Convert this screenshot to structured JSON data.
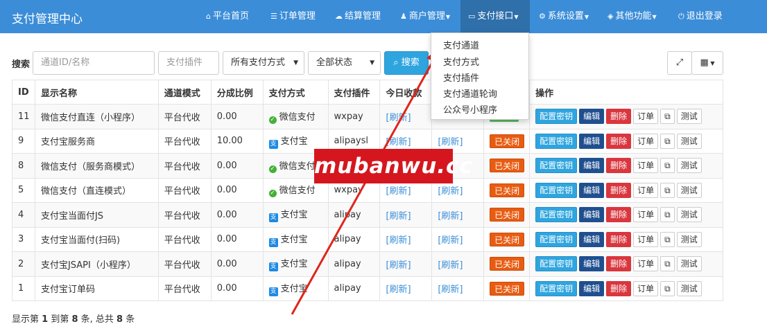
{
  "app": {
    "title": "支付管理中心"
  },
  "nav": [
    {
      "icon": "home-icon",
      "glyph": "⌂",
      "label": "平台首页"
    },
    {
      "icon": "list-icon",
      "glyph": "☰",
      "label": "订单管理"
    },
    {
      "icon": "cloud-icon",
      "glyph": "☁",
      "label": "结算管理"
    },
    {
      "icon": "user-icon",
      "glyph": "♟",
      "label": "商户管理"
    },
    {
      "icon": "credit-card-icon",
      "glyph": "▭",
      "label": "支付接口"
    },
    {
      "icon": "gear-icon",
      "glyph": "⚙",
      "label": "系统设置"
    },
    {
      "icon": "cube-icon",
      "glyph": "◈",
      "label": "其他功能"
    },
    {
      "icon": "power-icon",
      "glyph": "⏻",
      "label": "退出登录"
    }
  ],
  "dropdown": [
    "支付通道",
    "支付方式",
    "支付插件",
    "支付通道轮询",
    "公众号小程序"
  ],
  "search": {
    "label": "搜索",
    "id_placeholder": "通道ID/名称",
    "plugin_placeholder": "支付插件",
    "method_selected": "所有支付方式",
    "status_selected": "全部状态",
    "button": "搜索"
  },
  "table": {
    "headers": [
      "ID",
      "显示名称",
      "通道模式",
      "分成比例",
      "支付方式",
      "支付插件",
      "今日收款",
      "",
      "",
      "操作"
    ],
    "rows": [
      {
        "id": "11",
        "name": "微信支付直连（小程序）",
        "mode": "平台代收",
        "ratio": "0.00",
        "method": "微信支付",
        "method_icon": "wechat-icon",
        "plugin": "wxpay",
        "today": "[刷新]",
        "yesterday": "",
        "status": "",
        "status_kind": "open"
      },
      {
        "id": "9",
        "name": "支付宝服务商",
        "mode": "平台代收",
        "ratio": "10.00",
        "method": "支付宝",
        "method_icon": "alipay-icon",
        "plugin": "alipaysl",
        "today": "[刷新]",
        "yesterday": "[刷新]",
        "status": "已关闭",
        "status_kind": "closed"
      },
      {
        "id": "8",
        "name": "微信支付（服务商模式）",
        "mode": "平台代收",
        "ratio": "0.00",
        "method": "微信支付",
        "method_icon": "wechat-icon",
        "plugin": "",
        "today": "",
        "yesterday": "",
        "status": "已关闭",
        "status_kind": "closed"
      },
      {
        "id": "5",
        "name": "微信支付（直连模式）",
        "mode": "平台代收",
        "ratio": "0.00",
        "method": "微信支付",
        "method_icon": "wechat-icon",
        "plugin": "wxpay",
        "today": "[刷新]",
        "yesterday": "[刷新]",
        "status": "已关闭",
        "status_kind": "closed"
      },
      {
        "id": "4",
        "name": "支付宝当面付JS",
        "mode": "平台代收",
        "ratio": "0.00",
        "method": "支付宝",
        "method_icon": "alipay-icon",
        "plugin": "alipay",
        "today": "[刷新]",
        "yesterday": "[刷新]",
        "status": "已关闭",
        "status_kind": "closed"
      },
      {
        "id": "3",
        "name": "支付宝当面付(扫码)",
        "mode": "平台代收",
        "ratio": "0.00",
        "method": "支付宝",
        "method_icon": "alipay-icon",
        "plugin": "alipay",
        "today": "[刷新]",
        "yesterday": "[刷新]",
        "status": "已关闭",
        "status_kind": "closed"
      },
      {
        "id": "2",
        "name": "支付宝JSAPI（小程序）",
        "mode": "平台代收",
        "ratio": "0.00",
        "method": "支付宝",
        "method_icon": "alipay-icon",
        "plugin": "alipay",
        "today": "[刷新]",
        "yesterday": "[刷新]",
        "status": "已关闭",
        "status_kind": "closed"
      },
      {
        "id": "1",
        "name": "支付宝订单码",
        "mode": "平台代收",
        "ratio": "0.00",
        "method": "支付宝",
        "method_icon": "alipay-icon",
        "plugin": "alipay",
        "today": "[刷新]",
        "yesterday": "[刷新]",
        "status": "已关闭",
        "status_kind": "closed"
      }
    ],
    "ops": {
      "key": "配置密钥",
      "edit": "编辑",
      "del": "删除",
      "order": "订单",
      "copy": "⧉",
      "test": "测试"
    }
  },
  "footer": {
    "prefix": "显示第 ",
    "from": "1",
    "mid": " 到第 ",
    "to": "8",
    "mid2": " 条, 总共 ",
    "total": "8",
    "suffix": " 条"
  },
  "watermark": "mubanwu.cc",
  "colors": {
    "topbar": "#3c8dd8",
    "nav_active": "#2f6faa",
    "primary_btn": "#2fa5df",
    "edit_btn": "#1f4f8f",
    "delete_btn": "#d9363e",
    "closed_badge": "#e85c12",
    "open_badge": "#5cb85c",
    "arrow": "#e0241b",
    "watermark_bg": "#d6161e"
  }
}
